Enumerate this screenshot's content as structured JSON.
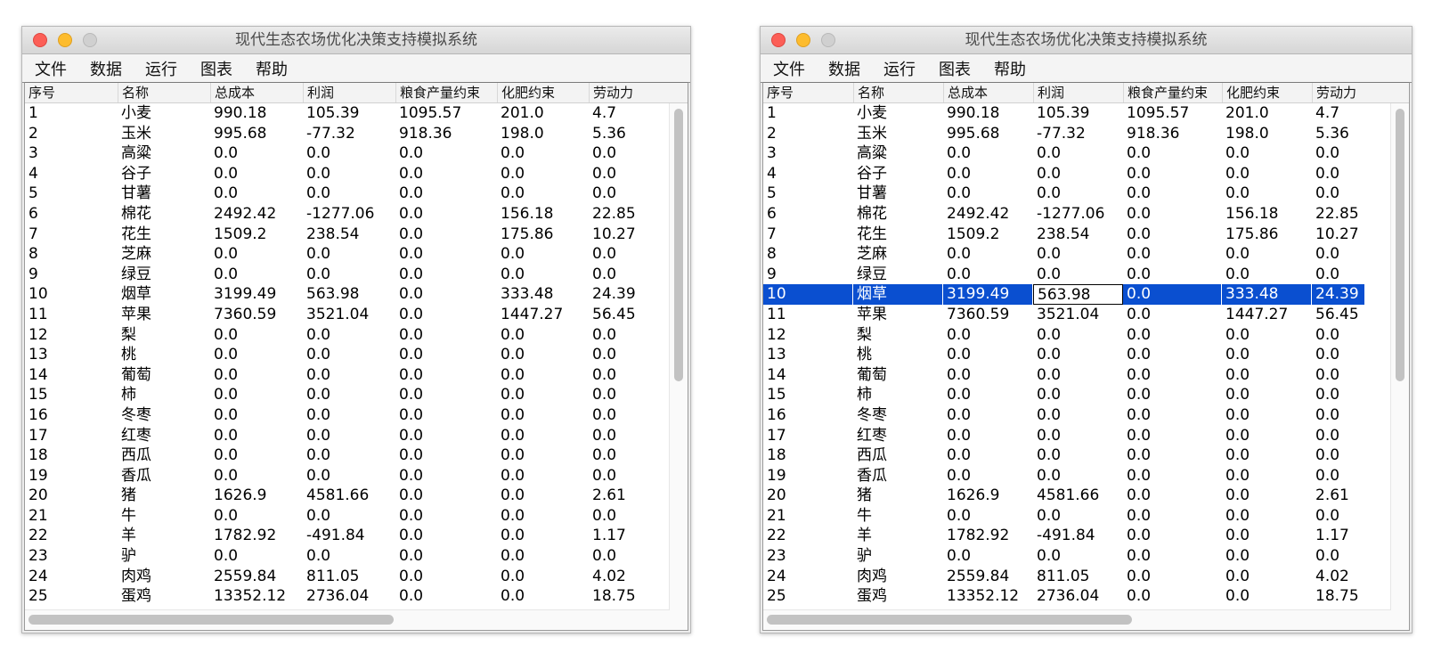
{
  "window": {
    "title": "现代生态农场优化决策支持模拟系统"
  },
  "menu": [
    "文件",
    "数据",
    "运行",
    "图表",
    "帮助"
  ],
  "table": {
    "headers": [
      "序号",
      "名称",
      "总成本",
      "利润",
      "粮食产量约束",
      "化肥约束",
      "劳动力"
    ],
    "rows": [
      [
        "1",
        "小麦",
        "990.18",
        "105.39",
        "1095.57",
        "201.0",
        "4.7"
      ],
      [
        "2",
        "玉米",
        "995.68",
        "-77.32",
        "918.36",
        "198.0",
        "5.36"
      ],
      [
        "3",
        "高粱",
        "0.0",
        "0.0",
        "0.0",
        "0.0",
        "0.0"
      ],
      [
        "4",
        "谷子",
        "0.0",
        "0.0",
        "0.0",
        "0.0",
        "0.0"
      ],
      [
        "5",
        "甘薯",
        "0.0",
        "0.0",
        "0.0",
        "0.0",
        "0.0"
      ],
      [
        "6",
        "棉花",
        "2492.42",
        "-1277.06",
        "0.0",
        "156.18",
        "22.85"
      ],
      [
        "7",
        "花生",
        "1509.2",
        "238.54",
        "0.0",
        "175.86",
        "10.27"
      ],
      [
        "8",
        "芝麻",
        "0.0",
        "0.0",
        "0.0",
        "0.0",
        "0.0"
      ],
      [
        "9",
        "绿豆",
        "0.0",
        "0.0",
        "0.0",
        "0.0",
        "0.0"
      ],
      [
        "10",
        "烟草",
        "3199.49",
        "563.98",
        "0.0",
        "333.48",
        "24.39"
      ],
      [
        "11",
        "苹果",
        "7360.59",
        "3521.04",
        "0.0",
        "1447.27",
        "56.45"
      ],
      [
        "12",
        "梨",
        "0.0",
        "0.0",
        "0.0",
        "0.0",
        "0.0"
      ],
      [
        "13",
        "桃",
        "0.0",
        "0.0",
        "0.0",
        "0.0",
        "0.0"
      ],
      [
        "14",
        "葡萄",
        "0.0",
        "0.0",
        "0.0",
        "0.0",
        "0.0"
      ],
      [
        "15",
        "柿",
        "0.0",
        "0.0",
        "0.0",
        "0.0",
        "0.0"
      ],
      [
        "16",
        "冬枣",
        "0.0",
        "0.0",
        "0.0",
        "0.0",
        "0.0"
      ],
      [
        "17",
        "红枣",
        "0.0",
        "0.0",
        "0.0",
        "0.0",
        "0.0"
      ],
      [
        "18",
        "西瓜",
        "0.0",
        "0.0",
        "0.0",
        "0.0",
        "0.0"
      ],
      [
        "19",
        "香瓜",
        "0.0",
        "0.0",
        "0.0",
        "0.0",
        "0.0"
      ],
      [
        "20",
        "猪",
        "1626.9",
        "4581.66",
        "0.0",
        "0.0",
        "2.61"
      ],
      [
        "21",
        "牛",
        "0.0",
        "0.0",
        "0.0",
        "0.0",
        "0.0"
      ],
      [
        "22",
        "羊",
        "1782.92",
        "-491.84",
        "0.0",
        "0.0",
        "1.17"
      ],
      [
        "23",
        "驴",
        "0.0",
        "0.0",
        "0.0",
        "0.0",
        "0.0"
      ],
      [
        "24",
        "肉鸡",
        "2559.84",
        "811.05",
        "0.0",
        "0.0",
        "4.02"
      ],
      [
        "25",
        "蛋鸡",
        "13352.12",
        "2736.04",
        "0.0",
        "0.0",
        "18.75"
      ]
    ]
  },
  "selection": {
    "selected_row_index": 9,
    "editing_column_index": 3
  },
  "colors": {
    "selection": "#0a4fd0",
    "close": "#fc5f57",
    "minimize": "#fdbc2e",
    "zoom_disabled": "#d0d0d0"
  }
}
